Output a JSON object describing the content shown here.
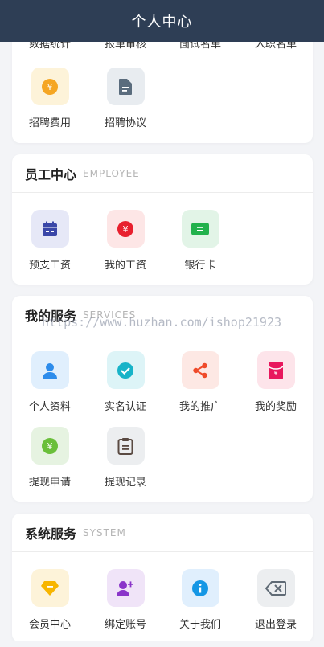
{
  "header": {
    "title": "个人中心"
  },
  "card_top": {
    "cut_labels": [
      "数据统计",
      "报单审核",
      "面试名单",
      "入职名单"
    ],
    "items": [
      {
        "label": "招聘费用",
        "icon": "yuan-coin-icon",
        "bg": "#fdf3d9",
        "color": "#f5a623"
      },
      {
        "label": "招聘协议",
        "icon": "document-icon",
        "bg": "#e8ecf0",
        "color": "#5a6c7d"
      }
    ]
  },
  "employee": {
    "title": "员工中心",
    "subtitle": "EMPLOYEE",
    "items": [
      {
        "label": "预支工资",
        "icon": "calendar-icon",
        "bg": "#e6e8f7",
        "color": "#3a47a8"
      },
      {
        "label": "我的工资",
        "icon": "yuan-icon",
        "bg": "#fde6e6",
        "color": "#e8202e"
      },
      {
        "label": "银行卡",
        "icon": "bank-card-icon",
        "bg": "#e2f4e7",
        "color": "#22b14c"
      }
    ]
  },
  "services": {
    "title": "我的服务",
    "subtitle": "SERVICES",
    "items": [
      {
        "label": "个人资料",
        "icon": "user-icon",
        "bg": "#e0effd",
        "color": "#2d8ceb"
      },
      {
        "label": "实名认证",
        "icon": "check-icon",
        "bg": "#ddf4f7",
        "color": "#17b3c8"
      },
      {
        "label": "我的推广",
        "icon": "share-icon",
        "bg": "#fde8e4",
        "color": "#ef4a2a"
      },
      {
        "label": "我的奖励",
        "icon": "red-envelope-icon",
        "bg": "#fde4ea",
        "color": "#e8175d"
      },
      {
        "label": "提现申请",
        "icon": "yuan-green-icon",
        "bg": "#e6f3e1",
        "color": "#6abf3a"
      },
      {
        "label": "提现记录",
        "icon": "clipboard-icon",
        "bg": "#eceef0",
        "color": "#5a4a42"
      }
    ]
  },
  "system": {
    "title": "系统服务",
    "subtitle": "SYSTEM",
    "items": [
      {
        "label": "会员中心",
        "icon": "diamond-icon",
        "bg": "#fdf3d9",
        "color": "#f7b500"
      },
      {
        "label": "绑定账号",
        "icon": "add-user-icon",
        "bg": "#f0e4f8",
        "color": "#8a35c9"
      },
      {
        "label": "关于我们",
        "icon": "info-icon",
        "bg": "#e0effd",
        "color": "#1597e5"
      },
      {
        "label": "退出登录",
        "icon": "backspace-icon",
        "bg": "#eceef0",
        "color": "#5f6a75"
      }
    ]
  },
  "watermark": "https://www.huzhan.com/ishop21923"
}
